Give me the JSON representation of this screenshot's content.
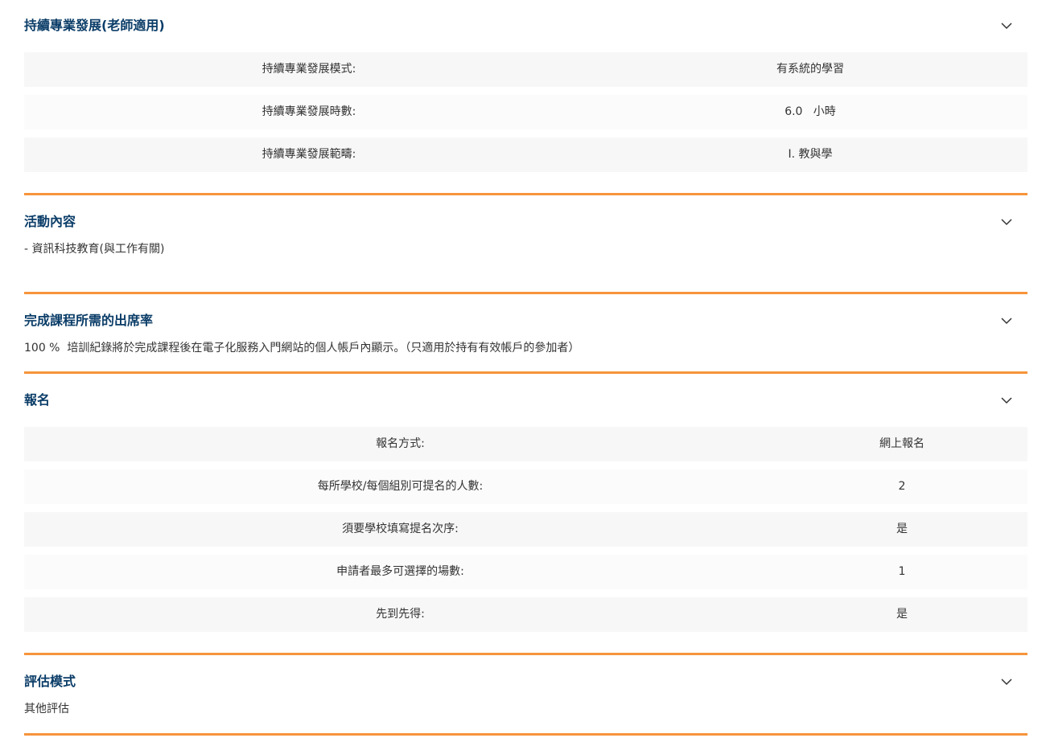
{
  "sections": {
    "cpd": {
      "title": "持續專業發展(老師適用)",
      "rows": [
        {
          "label": "持續專業發展模式:",
          "value": "有系統的學習"
        },
        {
          "label": "持續專業發展時數:",
          "value": "6.0   小時"
        },
        {
          "label": "持續專業發展範疇:",
          "value": "I. 教與學"
        }
      ]
    },
    "content": {
      "title": "活動內容",
      "text": "- 資訊科技教育(與工作有關)"
    },
    "attendance": {
      "title": "完成課程所需的出席率",
      "text": "100 %  培訓紀錄將於完成課程後在電子化服務入門網站的個人帳戶內顯示。（只適用於持有有效帳戶的參加者）"
    },
    "enrol": {
      "title": "報名",
      "rows": [
        {
          "label": "報名方式:",
          "value": "網上報名"
        },
        {
          "label": "每所學校/每個組別可提名的人數:",
          "value": "2"
        },
        {
          "label": "須要學校填寫提名次序:",
          "value": "是"
        },
        {
          "label": "申請者最多可選擇的場數:",
          "value": "1"
        },
        {
          "label": "先到先得:",
          "value": "是"
        }
      ]
    },
    "assessment": {
      "title": "評估模式",
      "text": "其他評估"
    }
  },
  "icons": {
    "toggle": "chevron-down-icon"
  },
  "colors": {
    "title": "#0b3d68",
    "divider": "#f7943b",
    "row_shaded": "#f7f7f7"
  }
}
